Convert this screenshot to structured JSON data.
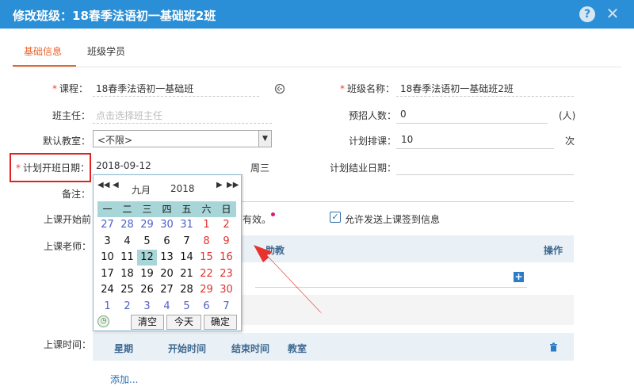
{
  "window": {
    "title": "修改班级：18春季法语初一基础班2班",
    "help_glyph": "?",
    "close_glyph": "✕"
  },
  "tabs": [
    {
      "label": "基础信息",
      "active": true
    },
    {
      "label": "班级学员",
      "active": false
    }
  ],
  "form": {
    "course_label": "课程：",
    "course_value": "18春季法语初一基础班",
    "course_icon": "link-icon",
    "class_name_label": "班级名称：",
    "class_name_value": "18春季法语初一基础班2班",
    "head_teacher_label": "班主任：",
    "head_teacher_placeholder": "点击选择班主任",
    "enroll_label": "预招人数：",
    "enroll_value": "0",
    "enroll_unit": "(人)",
    "classroom_label": "默认教室：",
    "classroom_value": "<不限>",
    "plan_count_label": "计划排课：",
    "plan_count_value": "10",
    "plan_count_unit": "次",
    "start_date_label": "计划开班日期：",
    "start_date_value": "2018-09-12",
    "weekday": "周三",
    "end_date_label": "计划结业日期：",
    "end_date_value": "",
    "note_label": "备注：",
    "class_start_label": "上课开始前",
    "valid_suffix": "有效。",
    "send_checkin_label": "允许发送上课签到信息",
    "send_checkin_checked": true,
    "teacher_label": "上课老师：",
    "assistant_header": "助教",
    "action_header": "操作",
    "time_label": "上课时间：",
    "time_headers": [
      "星期",
      "开始时间",
      "结束时间",
      "教室"
    ],
    "add_link": "添加..."
  },
  "calendar": {
    "nav_prev_year": "◀◀",
    "nav_prev_month": "◀",
    "nav_next_month": "▶",
    "nav_next_year": "▶▶",
    "month": "九月",
    "year": "2018",
    "weekdays": [
      "一",
      "二",
      "三",
      "四",
      "五",
      "六",
      "日"
    ],
    "weeks": [
      [
        "27",
        "28",
        "29",
        "30",
        "31",
        "1",
        "2"
      ],
      [
        "3",
        "4",
        "5",
        "6",
        "7",
        "8",
        "9"
      ],
      [
        "10",
        "11",
        "12",
        "13",
        "14",
        "15",
        "16"
      ],
      [
        "17",
        "18",
        "19",
        "20",
        "21",
        "22",
        "23"
      ],
      [
        "24",
        "25",
        "26",
        "27",
        "28",
        "29",
        "30"
      ],
      [
        "1",
        "2",
        "3",
        "4",
        "5",
        "6",
        "7"
      ]
    ],
    "selected_day": "12",
    "clear_label": "清空",
    "today_label": "今天",
    "ok_label": "确定"
  },
  "colors": {
    "title_bar": "#2a8fd6",
    "accent": "#e8632c",
    "highlight_box": "#e0211f",
    "arrow": "#e8322e"
  }
}
